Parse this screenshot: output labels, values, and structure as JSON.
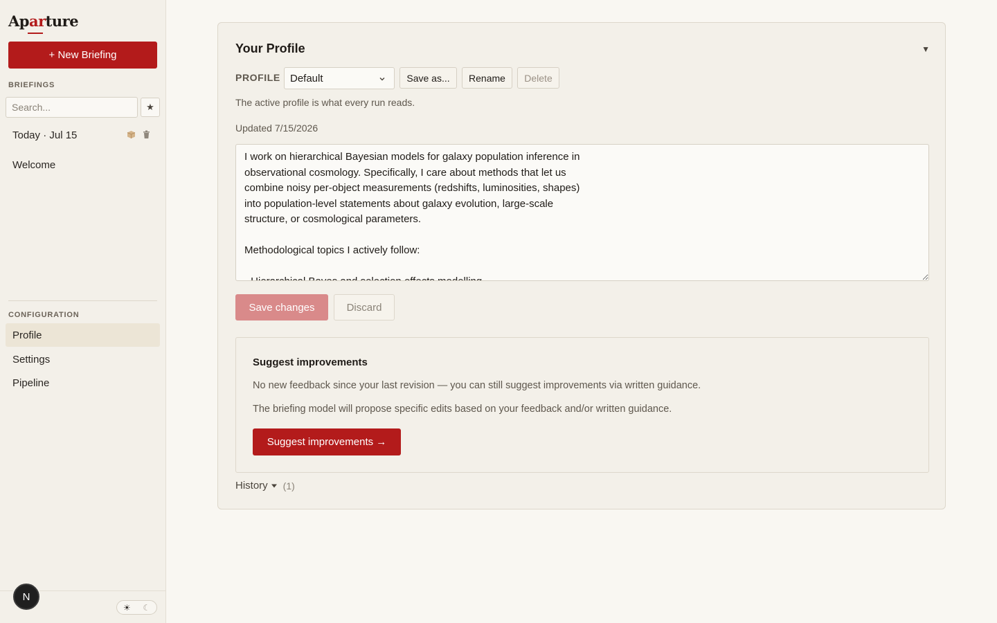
{
  "app": {
    "logo_pre": "Ap",
    "logo_accent": "ar",
    "logo_post": "ture"
  },
  "sidebar": {
    "new_briefing_label": "+ New Briefing",
    "briefings_heading": "BRIEFINGS",
    "search_placeholder": "Search...",
    "star_icon": "★",
    "briefings": [
      {
        "label": "Today · Jul 15"
      },
      {
        "label": "Welcome"
      }
    ],
    "configuration_heading": "CONFIGURATION",
    "config_items": [
      {
        "label": "Profile",
        "active": true
      },
      {
        "label": "Settings",
        "active": false
      },
      {
        "label": "Pipeline",
        "active": false
      }
    ],
    "avatar_initial": "N",
    "theme": {
      "sun": "☀",
      "moon": "☾"
    }
  },
  "profile_card": {
    "title": "Your Profile",
    "collapse_icon": "▼",
    "profile_label": "PROFILE",
    "selected_profile": "Default",
    "save_as_label": "Save as...",
    "rename_label": "Rename",
    "delete_label": "Delete",
    "helper_text": "The active profile is what every run reads.",
    "updated_text": "Updated 7/15/2026",
    "profile_text": "I work on hierarchical Bayesian models for galaxy population inference in\nobservational cosmology. Specifically, I care about methods that let us\ncombine noisy per-object measurements (redshifts, luminosities, shapes)\ninto population-level statements about galaxy evolution, large-scale\nstructure, or cosmological parameters.\n\nMethodological topics I actively follow:\n\n- Hierarchical Bayes and selection effects modelling",
    "save_changes_label": "Save changes",
    "discard_label": "Discard"
  },
  "suggest": {
    "title": "Suggest improvements",
    "line1": "No new feedback since your last revision — you can still suggest improvements via written guidance.",
    "line2": "The briefing model will propose specific edits based on your feedback and/or written guidance.",
    "button_label": "Suggest improvements →"
  },
  "history": {
    "label": "History",
    "count": "(1)"
  },
  "colors": {
    "accent": "#b31b1b",
    "accent_disabled": "#d98a8a",
    "background": "#f9f7f2",
    "sidebar": "#f3f0e9"
  }
}
